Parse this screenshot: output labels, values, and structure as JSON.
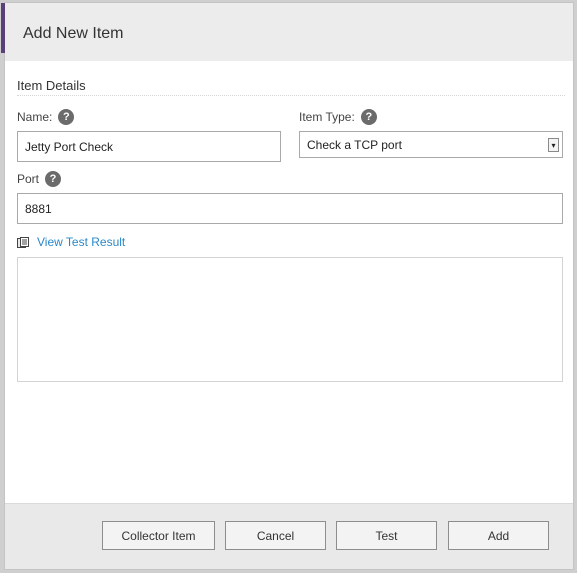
{
  "dialog": {
    "title": "Add New Item"
  },
  "section": {
    "title": "Item Details"
  },
  "fields": {
    "name": {
      "label": "Name:",
      "value": "Jetty Port Check",
      "help_icon": "question-circle-icon"
    },
    "item_type": {
      "label": "Item Type:",
      "value": "Check a TCP port",
      "help_icon": "question-circle-icon"
    },
    "port": {
      "label": "Port",
      "value": "8881",
      "help_icon": "question-circle-icon"
    }
  },
  "test_result": {
    "link_label": "View Test Result",
    "icon": "document-icon",
    "content": ""
  },
  "buttons": {
    "collector_item": "Collector Item",
    "cancel": "Cancel",
    "test": "Test",
    "add": "Add"
  },
  "colors": {
    "accent": "#5b3f7a",
    "link": "#2a88c8",
    "header_bg": "#ececec",
    "footer_bg": "#e9e9e9"
  }
}
